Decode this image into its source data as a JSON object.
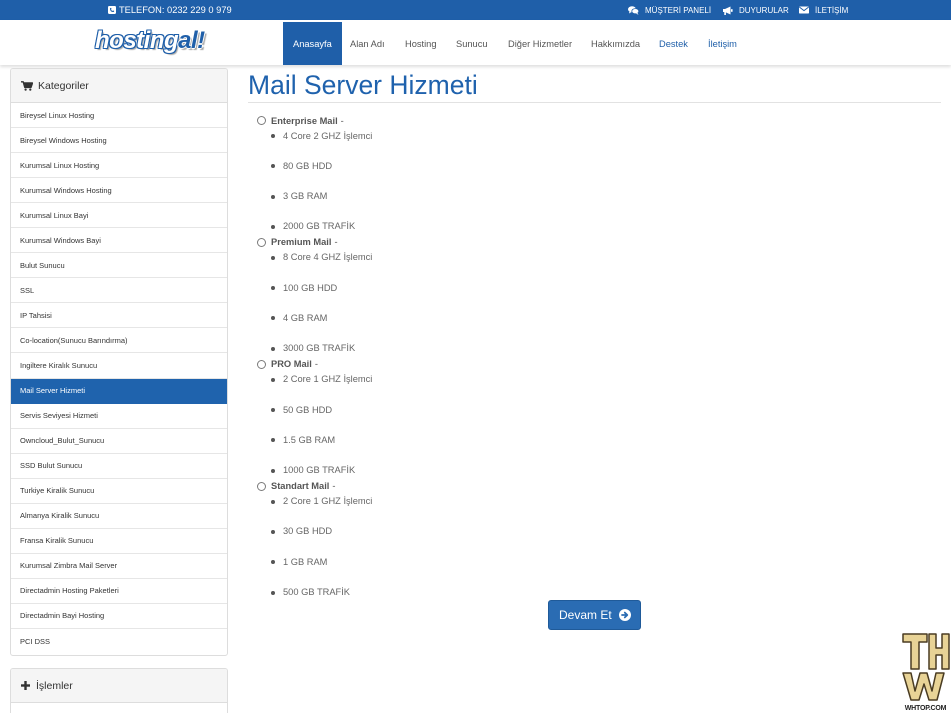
{
  "colors": {
    "accent": "#1f5fa9",
    "title": "#1f62ad",
    "active_category_bg": "#1f63ad",
    "button": "#2a6cb3",
    "panel_header_bg": "#f5f5f5"
  },
  "topbar": {
    "phone": "TELEFON: 0232 229 0 979",
    "phone_icon": "phone-square-icon",
    "links": [
      {
        "label": "MÜŞTERİ PANELİ",
        "icon": "comments-icon"
      },
      {
        "label": "DUYURULAR",
        "icon": "bullhorn-icon"
      },
      {
        "label": "İLETİŞİM",
        "icon": "envelope-icon"
      }
    ]
  },
  "logo": {
    "text_main": "hosting",
    "text_accent": "al!"
  },
  "nav": [
    {
      "label": "Anasayfa",
      "active": true
    },
    {
      "label": "Alan Adı"
    },
    {
      "label": "Hosting"
    },
    {
      "label": "Sunucu"
    },
    {
      "label": "Diğer Hizmetler"
    },
    {
      "label": "Hakkımızda"
    },
    {
      "label": "Destek"
    },
    {
      "label": "İletişim"
    }
  ],
  "sidebar": {
    "categories_title": "Kategoriler",
    "categories_icon": "shopping-cart-icon",
    "active_category": "Mail Server Hizmeti",
    "categories": [
      "Bireysel Linux Hosting",
      "Bireysel Windows Hosting",
      "Kurumsal Linux Hosting",
      "Kurumsal Windows Hosting",
      "Kurumsal Linux Bayi",
      "Kurumsal Windows Bayi",
      "Bulut Sunucu",
      "SSL",
      "IP Tahsisi",
      "Co-location(Sunucu Barındırma)",
      "Ingiltere Kiralık Sunucu",
      "Mail Server Hizmeti",
      "Servis Seviyesi Hizmeti",
      "Owncloud_Bulut_Sunucu",
      "SSD Bulut Sunucu",
      "Turkiye Kiralik Sunucu",
      "Almanya Kiralik Sunucu",
      "Fransa Kiralik Sunucu",
      "Kurumsal Zimbra Mail Server",
      "Directadmin Hosting Paketleri",
      "Directadmin Bayi Hosting",
      "PCI DSS"
    ],
    "actions_title": "İşlemler",
    "actions_icon": "plus-icon"
  },
  "main": {
    "title": "Mail Server Hizmeti",
    "plan_separator": "-",
    "plans": [
      {
        "name": "Enterprise Mail",
        "features": [
          "4 Core 2 GHZ İşlemci",
          "80 GB HDD",
          "3 GB RAM",
          "2000 GB TRAFİK"
        ]
      },
      {
        "name": "Premium Mail",
        "features": [
          "8 Core 4 GHZ İşlemci",
          "100 GB HDD",
          "4 GB RAM",
          "3000 GB TRAFİK"
        ]
      },
      {
        "name": "PRO Mail",
        "features": [
          "2 Core 1 GHZ İşlemci",
          "50 GB HDD",
          "1.5 GB RAM",
          "1000 GB TRAFİK"
        ]
      },
      {
        "name": "Standart Mail",
        "features": [
          "2 Core 1 GHZ İşlemci",
          "30 GB HDD",
          "1 GB RAM",
          "500 GB TRAFİK"
        ]
      }
    ],
    "submit_label": "Devam Et",
    "submit_icon": "arrow-circle-right-icon"
  },
  "watermark": {
    "text": "WHTOP.COM"
  }
}
